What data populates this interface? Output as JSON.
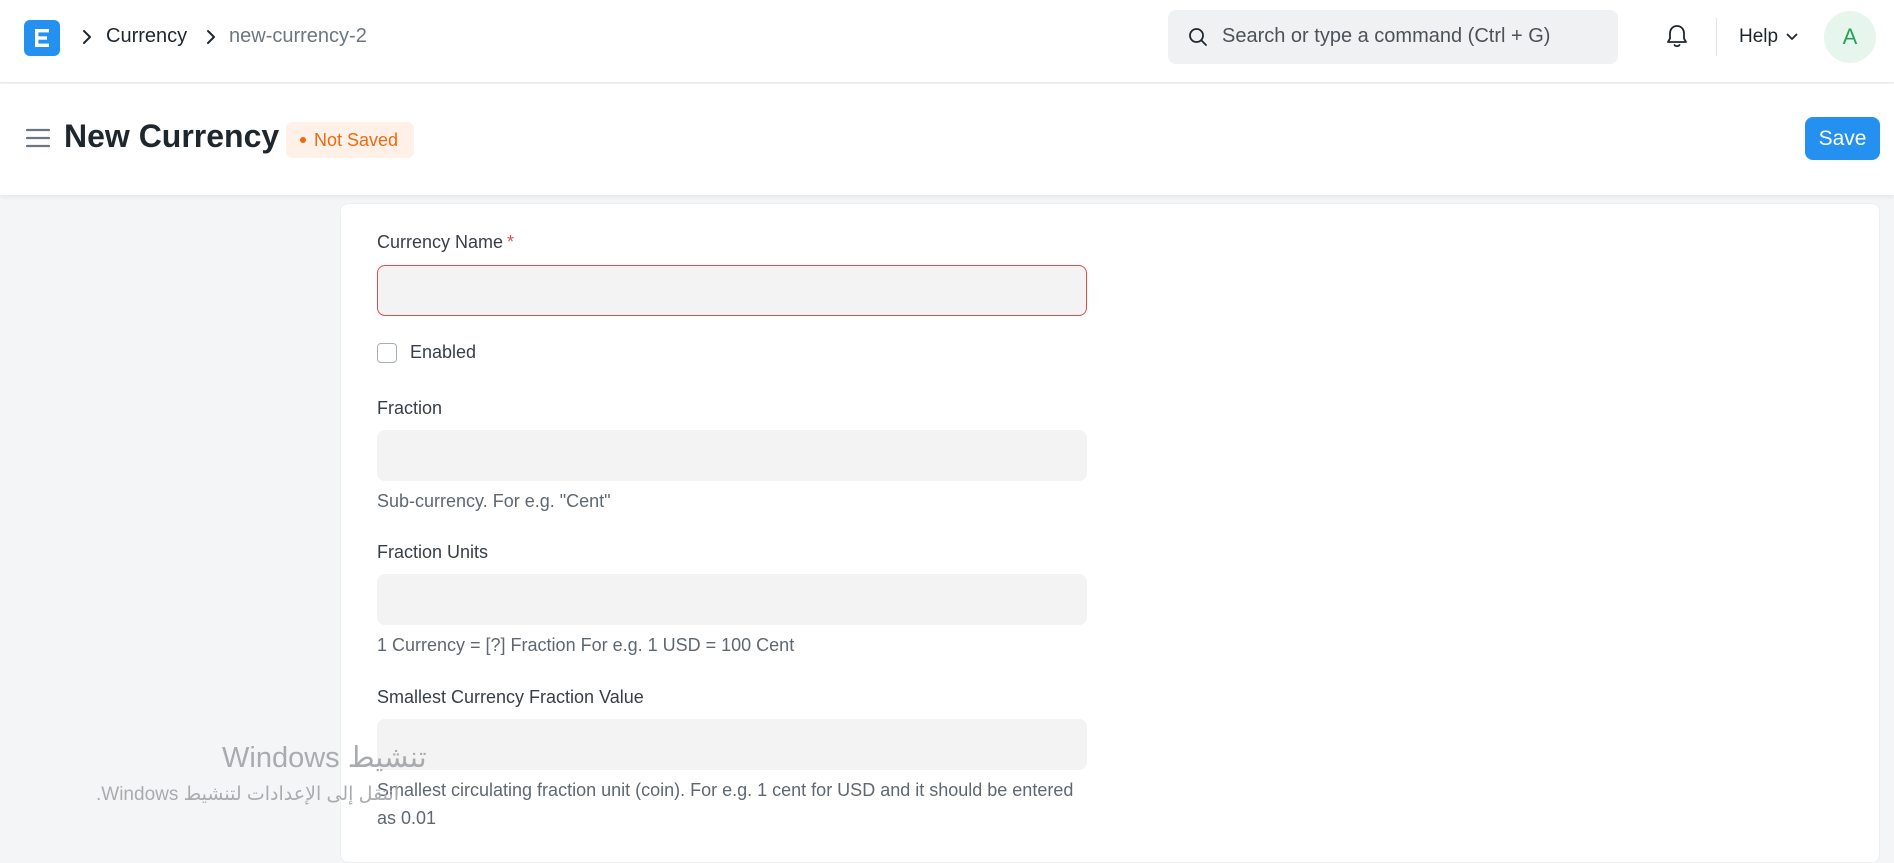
{
  "navbar": {
    "breadcrumbs": [
      {
        "label": "Currency"
      },
      {
        "label": "new-currency-2"
      }
    ],
    "search_placeholder": "Search or type a command (Ctrl + G)",
    "help_label": "Help",
    "avatar_initial": "A"
  },
  "page_head": {
    "title": "New Currency",
    "status": "Not Saved",
    "save_label": "Save"
  },
  "form": {
    "currency_name": {
      "label": "Currency Name",
      "required_mark": "*",
      "value": ""
    },
    "enabled": {
      "label": "Enabled",
      "checked": false
    },
    "fraction": {
      "label": "Fraction",
      "value": "",
      "help": "Sub-currency. For e.g. \"Cent\""
    },
    "fraction_units": {
      "label": "Fraction Units",
      "value": "",
      "help": "1 Currency = [?] Fraction For e.g. 1 USD = 100 Cent"
    },
    "smallest_fraction": {
      "label": "Smallest Currency Fraction Value",
      "value": "",
      "help": "Smallest circulating fraction unit (coin). For e.g. 1 cent for USD and it should be entered as 0.01"
    }
  },
  "watermark": {
    "title": "تنشيط Windows",
    "subtitle": "انتقل إلى الإعدادات لتنشيط Windows."
  },
  "colors": {
    "primary": "#2490ef",
    "status_orange": "#e86c13",
    "error_red": "#e24c4c",
    "avatar_green": "#29a35a"
  },
  "icons": [
    "app-logo-icon",
    "chevron-right-icon",
    "search-icon",
    "bell-icon",
    "chevron-down-icon",
    "hamburger-icon"
  ]
}
